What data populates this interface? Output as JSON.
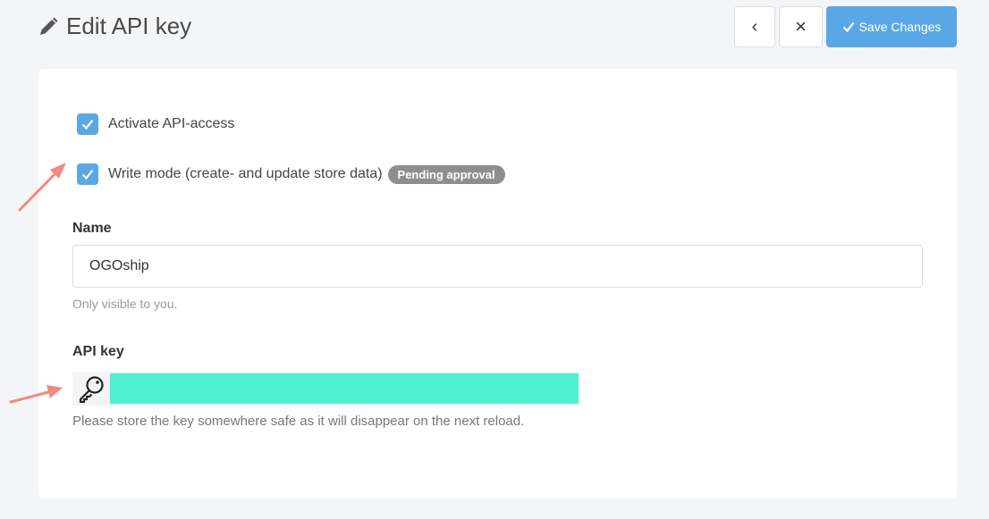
{
  "header": {
    "title": "Edit API key",
    "back_label": "‹",
    "close_label": "×",
    "save_label": "Save Changes"
  },
  "options": [
    {
      "label": "Activate API-access",
      "checked": true
    },
    {
      "label": "Write mode (create- and update store data)",
      "checked": true,
      "badge": "Pending approval"
    }
  ],
  "name_field": {
    "label": "Name",
    "value": "OGOship",
    "help": "Only visible to you."
  },
  "api_key": {
    "label": "API key",
    "value": "",
    "help": "Please store the key somewhere safe as it will disappear on the next reload."
  },
  "colors": {
    "accent": "#5aa7e6",
    "badge": "#8e8e8e",
    "redaction": "#4ff0d0",
    "arrow": "#f08a80"
  },
  "icons": [
    "pencil-icon",
    "chevron-left-icon",
    "close-icon",
    "check-icon",
    "key-icon"
  ]
}
